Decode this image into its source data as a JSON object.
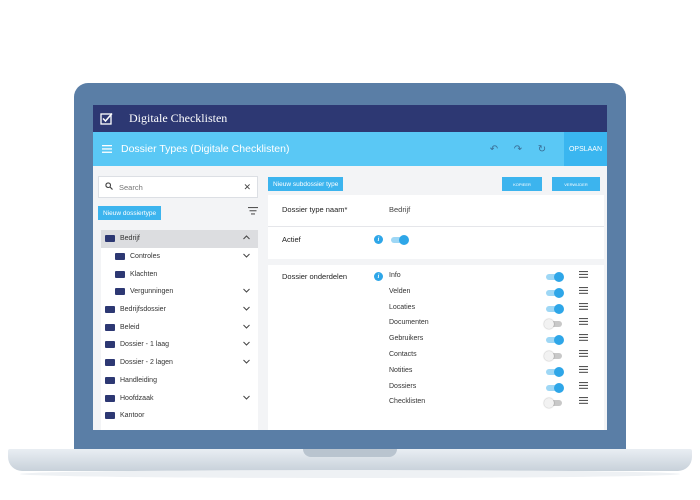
{
  "app": {
    "title": "Digitale Checklisten",
    "logo_icon": "checkbox-icon"
  },
  "toolbar": {
    "page_title": "Dossier Types (Digitale Checklisten)",
    "undo_icon": "undo-icon",
    "redo_icon": "redo-icon",
    "refresh_icon": "refresh-icon",
    "save_label": "OPSLAAN"
  },
  "sidebar": {
    "search_placeholder": "Search",
    "new_type_label": "Nieuw dossiertype",
    "tree": [
      {
        "label": "Bedrijf",
        "level": 0,
        "expanded": true,
        "active": true
      },
      {
        "label": "Controles",
        "level": 1,
        "expandable": true
      },
      {
        "label": "Klachten",
        "level": 1,
        "expandable": false
      },
      {
        "label": "Vergunningen",
        "level": 1,
        "expandable": true
      },
      {
        "label": "Bedrijfsdossier",
        "level": 0,
        "expandable": true
      },
      {
        "label": "Beleid",
        "level": 0,
        "expandable": true
      },
      {
        "label": "Dossier - 1 laag",
        "level": 0,
        "expandable": true
      },
      {
        "label": "Dossier - 2 lagen",
        "level": 0,
        "expandable": true
      },
      {
        "label": "Handleiding",
        "level": 0,
        "expandable": false
      },
      {
        "label": "Hoofdzaak",
        "level": 0,
        "expandable": true
      },
      {
        "label": "Kantoor",
        "level": 0,
        "expandable": false
      }
    ]
  },
  "main": {
    "new_subdossier_label": "Nieuw subdossier type",
    "copy_label": "KOPIEER",
    "delete_label": "VERWIJDER",
    "name_label": "Dossier type naam*",
    "name_value": "Bedrijf",
    "active_label": "Actief",
    "active_on": true,
    "parts_label": "Dossier onderdelen",
    "parts": [
      {
        "label": "Info",
        "on": true
      },
      {
        "label": "Velden",
        "on": true
      },
      {
        "label": "Locaties",
        "on": true
      },
      {
        "label": "Documenten",
        "on": false
      },
      {
        "label": "Gebruikers",
        "on": true
      },
      {
        "label": "Contacts",
        "on": false
      },
      {
        "label": "Notities",
        "on": true
      },
      {
        "label": "Dossiers",
        "on": true
      },
      {
        "label": "Checklisten",
        "on": false
      }
    ]
  },
  "colors": {
    "topbar": "#2d3873",
    "toolbar": "#5ac8f5",
    "accent": "#3cb4ee",
    "laptop": "#5a7ea6"
  }
}
